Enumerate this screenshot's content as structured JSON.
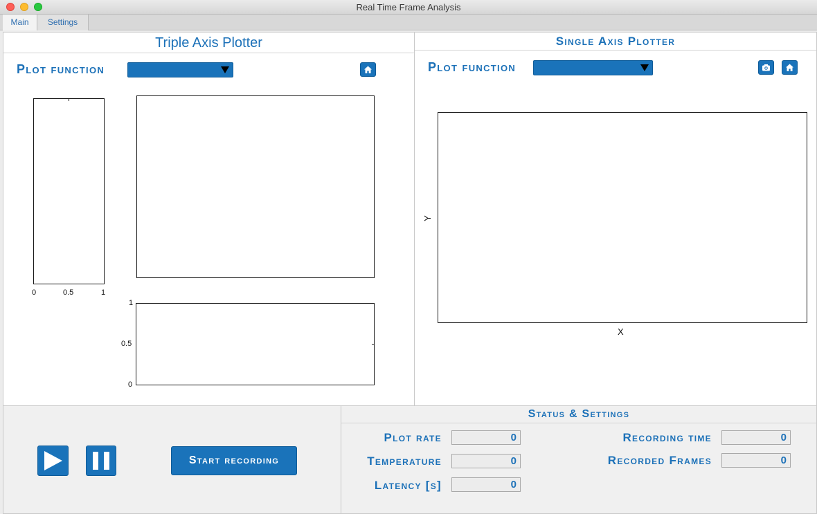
{
  "window": {
    "title": "Real Time Frame Analysis"
  },
  "tabs": [
    {
      "label": "Main",
      "active": true
    },
    {
      "label": "Settings",
      "active": false
    }
  ],
  "triple_axis": {
    "title": "Triple Axis Plotter",
    "plot_function_label": "Plot function",
    "dropdown_value": "",
    "home_icon": "home-icon",
    "left_axes": {
      "xticks": [
        "0",
        "0.5",
        "1"
      ]
    },
    "bottom_axes": {
      "yticks": [
        "1",
        "0.5",
        "0"
      ]
    }
  },
  "single_axis": {
    "title": "Single Axis Plotter",
    "plot_function_label": "Plot function",
    "dropdown_value": "",
    "camera_icon": "camera-icon",
    "home_icon": "home-icon",
    "xlabel": "X",
    "ylabel": "Y"
  },
  "controls": {
    "play_icon": "play-icon",
    "pause_icon": "pause-icon",
    "record_label": "Start recording"
  },
  "status": {
    "title": "Status & Settings",
    "plot_rate": {
      "label": "Plot rate",
      "value": "0"
    },
    "temperature": {
      "label": "Temperature",
      "value": "0"
    },
    "latency": {
      "label": "Latency [s]",
      "value": "0"
    },
    "recording_time": {
      "label": "Recording time",
      "value": "0"
    },
    "recorded_frames": {
      "label": "Recorded Frames",
      "value": "0"
    }
  },
  "colors": {
    "accent": "#1a73ba",
    "label_text": "#1c71b8",
    "panel_bg": "#ffffff",
    "window_bg": "#ececec"
  }
}
